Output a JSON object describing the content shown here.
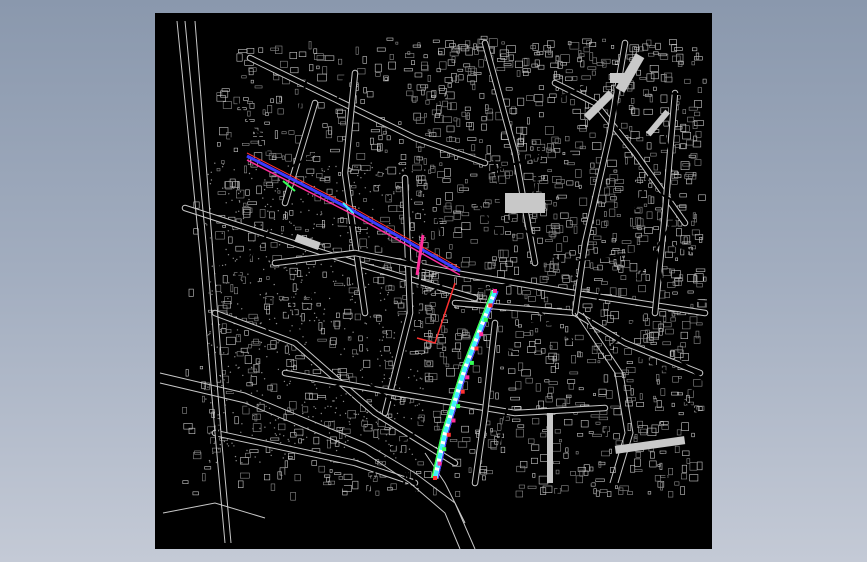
{
  "canvas": {
    "background": "#000000",
    "frame_gradient": [
      "#8a98ad",
      "#c4cad6"
    ]
  },
  "colors": {
    "linework": "#c8c8c8",
    "linework_dim": "#8c8c8c",
    "road_fill": "#000000",
    "highlight_blue": "#3a3aff",
    "highlight_magenta": "#ff2d9a",
    "highlight_cyan": "#3ff0ff",
    "highlight_green": "#33ff55",
    "highlight_red": "#ff3030",
    "highlight_white": "#ffffff"
  },
  "layers": [
    "streets",
    "blocks",
    "railway",
    "river",
    "survey-route-northwest",
    "survey-route-south"
  ]
}
